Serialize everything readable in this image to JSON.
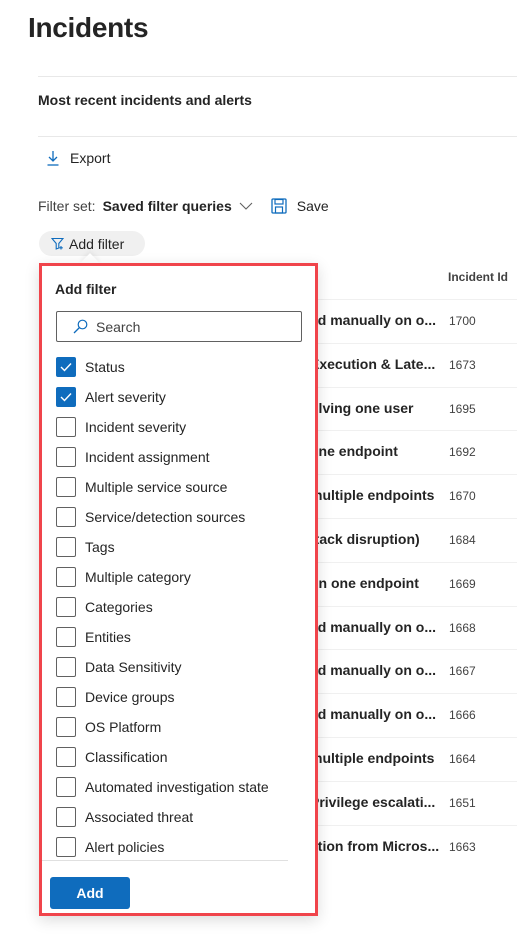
{
  "header": {
    "title": "Incidents"
  },
  "section": {
    "title": "Most recent incidents and alerts"
  },
  "toolbar": {
    "export_label": "Export",
    "filter_set_label": "Filter set:",
    "filter_set_value": "Saved filter queries",
    "save_label": "Save",
    "add_filter_label": "Add filter"
  },
  "table": {
    "columns": [
      "Incident Id"
    ],
    "rows": [
      {
        "name": "ed manually on o...",
        "id": "1700"
      },
      {
        "name": "Execution & Late...",
        "id": "1673"
      },
      {
        "name": "olving one user",
        "id": "1695"
      },
      {
        "name": "one endpoint",
        "id": "1692"
      },
      {
        "name": "multiple endpoints",
        "id": "1670"
      },
      {
        "name": "ttack disruption)",
        "id": "1684"
      },
      {
        "name": "on one endpoint",
        "id": "1669"
      },
      {
        "name": "ed manually on o...",
        "id": "1668"
      },
      {
        "name": "ed manually on o...",
        "id": "1667"
      },
      {
        "name": "ed manually on o...",
        "id": "1666"
      },
      {
        "name": "multiple endpoints",
        "id": "1664"
      },
      {
        "name": "Privilege escalati...",
        "id": "1651"
      },
      {
        "name": "ation from Micros...",
        "id": "1663"
      }
    ]
  },
  "add_filter_panel": {
    "title": "Add filter",
    "search_placeholder": "Search",
    "search_value": "",
    "options": [
      {
        "label": "Status",
        "checked": true
      },
      {
        "label": "Alert severity",
        "checked": true
      },
      {
        "label": "Incident severity",
        "checked": false
      },
      {
        "label": "Incident assignment",
        "checked": false
      },
      {
        "label": "Multiple service source",
        "checked": false
      },
      {
        "label": "Service/detection sources",
        "checked": false
      },
      {
        "label": "Tags",
        "checked": false
      },
      {
        "label": "Multiple category",
        "checked": false
      },
      {
        "label": "Categories",
        "checked": false
      },
      {
        "label": "Entities",
        "checked": false
      },
      {
        "label": "Data Sensitivity",
        "checked": false
      },
      {
        "label": "Device groups",
        "checked": false
      },
      {
        "label": "OS Platform",
        "checked": false
      },
      {
        "label": "Classification",
        "checked": false
      },
      {
        "label": "Automated investigation state",
        "checked": false
      },
      {
        "label": "Associated threat",
        "checked": false
      },
      {
        "label": "Alert policies",
        "checked": false
      }
    ],
    "add_button_label": "Add"
  },
  "colors": {
    "accent": "#0f6cbd",
    "highlight_border": "#f0444b"
  }
}
